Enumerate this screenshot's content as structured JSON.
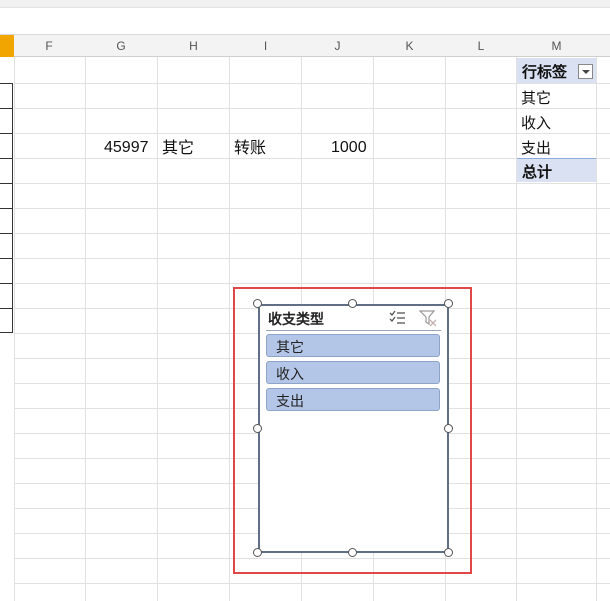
{
  "columns": [
    "F",
    "G",
    "H",
    "I",
    "J",
    "K",
    "L",
    "M"
  ],
  "row": {
    "g": "45997",
    "h": "其它",
    "i": "转账",
    "j": "1000"
  },
  "pivot": {
    "header": "行标签",
    "items": [
      "其它",
      "收入",
      "支出"
    ],
    "total": "总计"
  },
  "slicer": {
    "title": "收支类型",
    "items": [
      "其它",
      "收入",
      "支出"
    ],
    "icons": [
      "multi-select-icon",
      "clear-filter-icon"
    ]
  },
  "colors": {
    "pivot_header": "#d9e1f2",
    "slicer_item": "#b4c6e7",
    "selection_box": "#e04848",
    "active_cell_orange": "#f2a900"
  }
}
